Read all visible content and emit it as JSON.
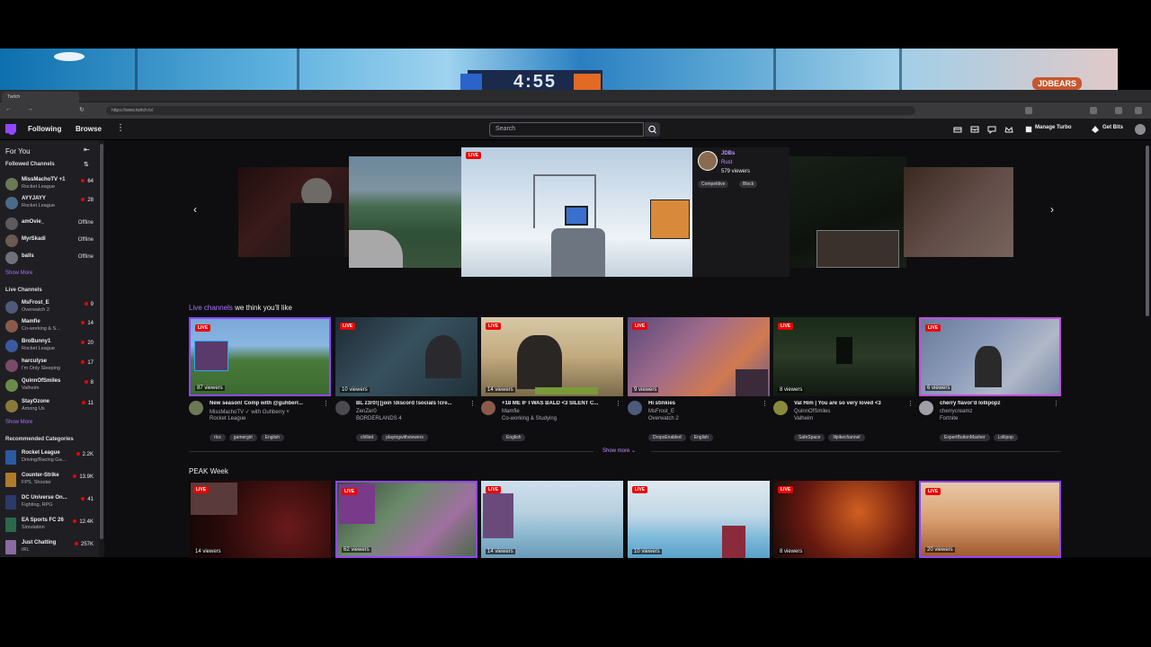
{
  "game_overlay": {
    "timer": "4:55",
    "banner": "JDBEARS"
  },
  "browser": {
    "tab_title": "Twitch",
    "url": "https://www.twitch.tv/"
  },
  "topnav": {
    "following": "Following",
    "browse": "Browse",
    "search_placeholder": "Search",
    "manage_turbo": "Manage Turbo",
    "get_bits": "Get Bits"
  },
  "sidebar": {
    "for_you": "For You",
    "followed_title": "Followed Channels",
    "followed": [
      {
        "name": "MissMachoTV +1",
        "game": "Rocket League",
        "count": "64",
        "live": true,
        "color": "#6b7a55"
      },
      {
        "name": "AYYJAYY",
        "game": "Rocket League",
        "count": "28",
        "live": true,
        "color": "#4a6a8a"
      },
      {
        "name": "amOvie_",
        "game": "",
        "count": "Offline",
        "live": false,
        "color": "#5a5a60"
      },
      {
        "name": "MyrSkadi",
        "game": "",
        "count": "Offline",
        "live": false,
        "color": "#6a5a50"
      },
      {
        "name": "balls",
        "game": "",
        "count": "Offline",
        "live": false,
        "color": "#70707a"
      }
    ],
    "show_more_1": "Show More",
    "live_title": "Live Channels",
    "live": [
      {
        "name": "MsFrost_E",
        "game": "Overwatch 2",
        "count": "9",
        "color": "#4d5a7a"
      },
      {
        "name": "Mamfie",
        "game": "Co-working & S...",
        "count": "14",
        "color": "#8a5a4a"
      },
      {
        "name": "BroBunny1",
        "game": "Rocket League",
        "count": "20",
        "color": "#3a5aa0"
      },
      {
        "name": "harculyse",
        "game": "I'm Only Sleeping",
        "count": "17",
        "color": "#7a4a6a"
      },
      {
        "name": "QuinnOfSmiles",
        "game": "Valheim",
        "count": "8",
        "color": "#6a8a4a"
      },
      {
        "name": "StayOzone",
        "game": "Among Us",
        "count": "11",
        "color": "#8a7a3a"
      }
    ],
    "show_more_2": "Show More",
    "rec_title": "Recommended Categories",
    "categories": [
      {
        "name": "Rocket League",
        "tags": "Driving/Racing Ga...",
        "count": "2.2K",
        "color": "#2a5aa0"
      },
      {
        "name": "Counter-Strike",
        "tags": "FPS, Shooter",
        "count": "13.9K",
        "color": "#b07a2a"
      },
      {
        "name": "DC Universe On...",
        "tags": "Fighting, RPG",
        "count": "41",
        "color": "#2a3a6a"
      },
      {
        "name": "EA Sports FC 26",
        "tags": "Simulation",
        "count": "12.4K",
        "color": "#2a6a4a"
      },
      {
        "name": "Just Chatting",
        "tags": "IRL",
        "count": "257K",
        "color": "#8a6aa0"
      }
    ]
  },
  "featured": {
    "live": "LIVE",
    "channel": "JDBs",
    "game": "Rust",
    "viewers": "579 viewers",
    "tags": [
      "Competitive",
      "Block"
    ]
  },
  "sections": {
    "live_title_hl": "Live channels",
    "live_title_rest": " we think you'll like",
    "show_more": "Show more",
    "peak_title": "PEAK Week"
  },
  "live_cards": [
    {
      "title": "New season! Comp with @guhberr...",
      "channel": "MissMachoTV ✓ with Guhberry ˅",
      "game": "Rocket League",
      "viewers": "87 viewers",
      "tags": [
        "rlcs",
        "gamergirl",
        "English"
      ],
      "avatar": "#6b7a55"
    },
    {
      "title": "BL z3r0!| [join !discord !socials !cre...",
      "channel": "ZenZer0",
      "game": "BORDERLANDS 4",
      "viewers": "10 viewers",
      "tags": [
        "chilled",
        "playingwithviewers"
      ],
      "avatar": "#4a4a50"
    },
    {
      "title": "+18 ME IF I WAS BALD <3 SILENT C...",
      "channel": "Mamfie",
      "game": "Co-working & Studying",
      "viewers": "14 viewers",
      "tags": [
        "English"
      ],
      "avatar": "#8a5a4a"
    },
    {
      "title": "Hi stinkies",
      "channel": "MsFrost_E",
      "game": "Overwatch 2",
      "viewers": "9 viewers",
      "tags": [
        "DropsEnabled",
        "English"
      ],
      "avatar": "#4d5a7a"
    },
    {
      "title": "Val Him | You are so very loved <3",
      "channel": "QuinnOfSmiles",
      "game": "Valheim",
      "viewers": "8 viewers",
      "tags": [
        "SafeSpace",
        "lilpikechannel"
      ],
      "avatar": "#8a8a3a"
    },
    {
      "title": "cherry flavor'd lollipopz",
      "channel": "cherrycreamz",
      "game": "Fortnite",
      "viewers": "6 viewers",
      "tags": [
        "ExpertButtonMasher",
        "Lollipop"
      ],
      "avatar": "#a0a0a8"
    }
  ],
  "peak_cards": [
    {
      "viewers": "14 viewers"
    },
    {
      "viewers": "62 viewers"
    },
    {
      "viewers": "14 viewers"
    },
    {
      "viewers": "10 viewers"
    },
    {
      "viewers": "8 viewers"
    },
    {
      "viewers": "20 viewers"
    }
  ],
  "live_label": "LIVE"
}
